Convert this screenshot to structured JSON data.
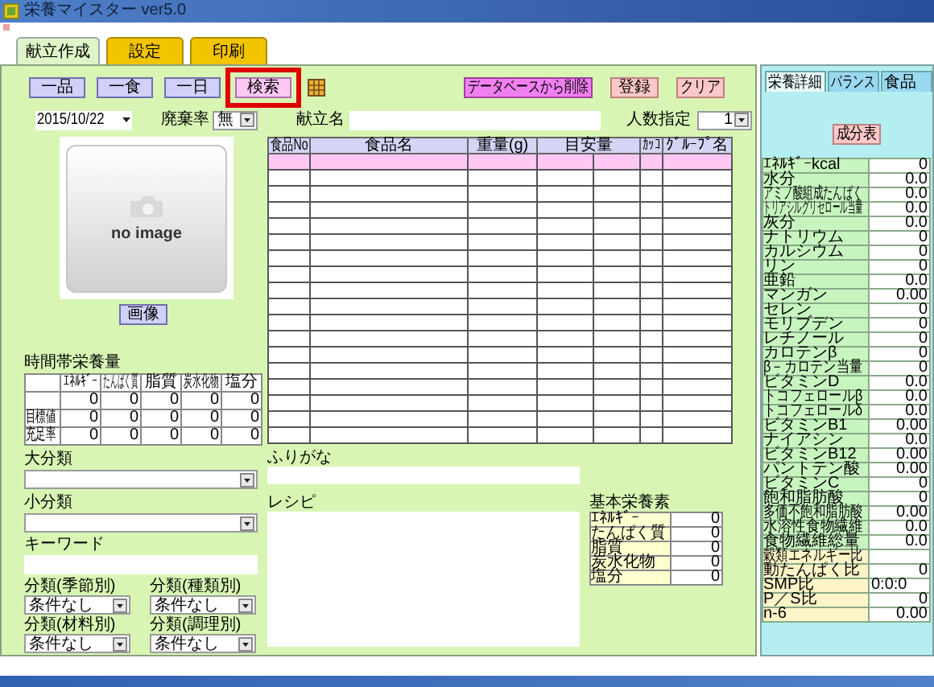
{
  "window": {
    "title": "栄養マイスター ver5.0"
  },
  "tabs": [
    {
      "label": "献立作成",
      "selected": true
    },
    {
      "label": "設定",
      "selected": false
    },
    {
      "label": "印刷",
      "selected": false
    }
  ],
  "mode_buttons": [
    {
      "label": "一品",
      "kind": "mode",
      "highlighted": false
    },
    {
      "label": "一食",
      "kind": "mode",
      "highlighted": false
    },
    {
      "label": "一日",
      "kind": "mode",
      "highlighted": false
    },
    {
      "label": "検索",
      "kind": "search",
      "highlighted": true
    }
  ],
  "actions": [
    {
      "label": "データベースから削除",
      "kind": "delete"
    },
    {
      "label": "登録",
      "kind": "plain"
    },
    {
      "label": "クリア",
      "kind": "plain"
    }
  ],
  "date": "2015/10/22",
  "waste_rate": {
    "label": "廃棄率",
    "value": "無"
  },
  "menu_name": {
    "label": "献立名"
  },
  "servings": {
    "label": "人数指定",
    "value": "1"
  },
  "photo": {
    "text": "no image",
    "button": "画像"
  },
  "time_nutrition": {
    "title": "時間帯栄養量",
    "columns": [
      "ｴﾈﾙｷﾞｰ",
      "たんぱく質",
      "脂質",
      "炭水化物",
      "塩分"
    ],
    "rows": [
      {
        "values": [
          "0",
          "0",
          "0",
          "0",
          "0"
        ]
      },
      {
        "label": "目標値",
        "values": [
          "0",
          "0",
          "0",
          "0",
          "0"
        ]
      },
      {
        "label": "充足率",
        "values": [
          "0",
          "0",
          "0",
          "0",
          "0"
        ]
      }
    ]
  },
  "filters": [
    {
      "label": "大分類"
    },
    {
      "label": "小分類"
    }
  ],
  "keyword": {
    "label": "キーワード"
  },
  "categories": [
    {
      "label": "分類(季節別)",
      "value": "条件なし"
    },
    {
      "label": "分類(種類別)",
      "value": "条件なし"
    },
    {
      "label": "分類(材料別)",
      "value": "条件なし"
    },
    {
      "label": "分類(調理別)",
      "value": "条件なし"
    }
  ],
  "food_table": {
    "columns": [
      "食品No",
      "食品名",
      "重量(g)",
      "目安量",
      "ｶｯｺ",
      "ｸﾞﾙｰﾌﾟ名"
    ],
    "rows": [
      {
        "selected": true
      },
      {
        "selected": false
      },
      {
        "selected": false
      },
      {
        "selected": false
      },
      {
        "selected": false
      },
      {
        "selected": false
      },
      {
        "selected": false
      },
      {
        "selected": false
      },
      {
        "selected": false
      },
      {
        "selected": false
      },
      {
        "selected": false
      },
      {
        "selected": false
      },
      {
        "selected": false
      },
      {
        "selected": false
      },
      {
        "selected": false
      },
      {
        "selected": false
      },
      {
        "selected": false
      },
      {
        "selected": false
      }
    ]
  },
  "furigana": {
    "label": "ふりがな"
  },
  "recipe": {
    "label": "レシピ"
  },
  "basic_nutrients": {
    "title": "基本栄養素",
    "rows": [
      {
        "label": "ｴﾈﾙｷﾞｰ",
        "value": "0"
      },
      {
        "label": "たんぱく質",
        "value": "0"
      },
      {
        "label": "脂質",
        "value": "0"
      },
      {
        "label": "炭水化物",
        "value": "0"
      },
      {
        "label": "塩分",
        "value": "0"
      }
    ]
  },
  "detail_panel": {
    "tabs": [
      {
        "label": "栄養詳細",
        "selected": true
      },
      {
        "label": "バランス",
        "selected": false
      },
      {
        "label": "食品",
        "selected": false
      }
    ],
    "buttons": [
      "成分表"
    ],
    "rows": [
      {
        "label": "ｴﾈﾙｷﾞｰkcal",
        "value": "0",
        "kind": "nutrient"
      },
      {
        "label": "水分",
        "value": "0.0",
        "kind": "nutrient"
      },
      {
        "label": "アミノ酸組成たんぱく",
        "value": "0.0",
        "kind": "nutrient"
      },
      {
        "label": "トリアシルグリセロール当量",
        "value": "0.0",
        "kind": "nutrient"
      },
      {
        "label": "灰分",
        "value": "0.0",
        "kind": "nutrient"
      },
      {
        "label": "ナトリウム",
        "value": "0",
        "kind": "nutrient"
      },
      {
        "label": "カルシウム",
        "value": "0",
        "kind": "nutrient"
      },
      {
        "label": "リン",
        "value": "0",
        "kind": "nutrient"
      },
      {
        "label": "亜鉛",
        "value": "0.0",
        "kind": "nutrient"
      },
      {
        "label": "マンガン",
        "value": "0.00",
        "kind": "nutrient"
      },
      {
        "label": "セレン",
        "value": "0",
        "kind": "nutrient"
      },
      {
        "label": "モリブデン",
        "value": "0",
        "kind": "nutrient"
      },
      {
        "label": "レチノール",
        "value": "0",
        "kind": "nutrient"
      },
      {
        "label": "カロテンβ",
        "value": "0",
        "kind": "nutrient"
      },
      {
        "label": "β－カロテン当量",
        "value": "0",
        "kind": "nutrient"
      },
      {
        "label": "ビタミンD",
        "value": "0.0",
        "kind": "nutrient"
      },
      {
        "label": "トコフェロールβ",
        "value": "0.0",
        "kind": "nutrient"
      },
      {
        "label": "トコフェロールδ",
        "value": "0.0",
        "kind": "nutrient"
      },
      {
        "label": "ビタミンB1",
        "value": "0.00",
        "kind": "nutrient"
      },
      {
        "label": "ナイアシン",
        "value": "0.0",
        "kind": "nutrient"
      },
      {
        "label": "ビタミンB12",
        "value": "0.00",
        "kind": "nutrient"
      },
      {
        "label": "パントテン酸",
        "value": "0.00",
        "kind": "nutrient"
      },
      {
        "label": "ビタミンC",
        "value": "0",
        "kind": "nutrient"
      },
      {
        "label": "飽和脂肪酸",
        "value": "0",
        "kind": "nutrient"
      },
      {
        "label": "多価不飽和脂肪酸",
        "value": "0.00",
        "kind": "nutrient"
      },
      {
        "label": "水溶性食物繊維",
        "value": "0.0",
        "kind": "nutrient"
      },
      {
        "label": "食物繊維総量",
        "value": "0.0",
        "kind": "nutrient"
      },
      {
        "label": "穀類エネルギー比",
        "kind": "ratio"
      },
      {
        "label": "動たんぱく比",
        "value": "0",
        "kind": "ratio"
      },
      {
        "label": "SMP比",
        "value": "0:0:0",
        "kind": "triple"
      },
      {
        "label": "P／S比",
        "value": "0",
        "kind": "ratio"
      },
      {
        "label": "n-6",
        "value": "0.00",
        "kind": "ratio"
      }
    ]
  }
}
